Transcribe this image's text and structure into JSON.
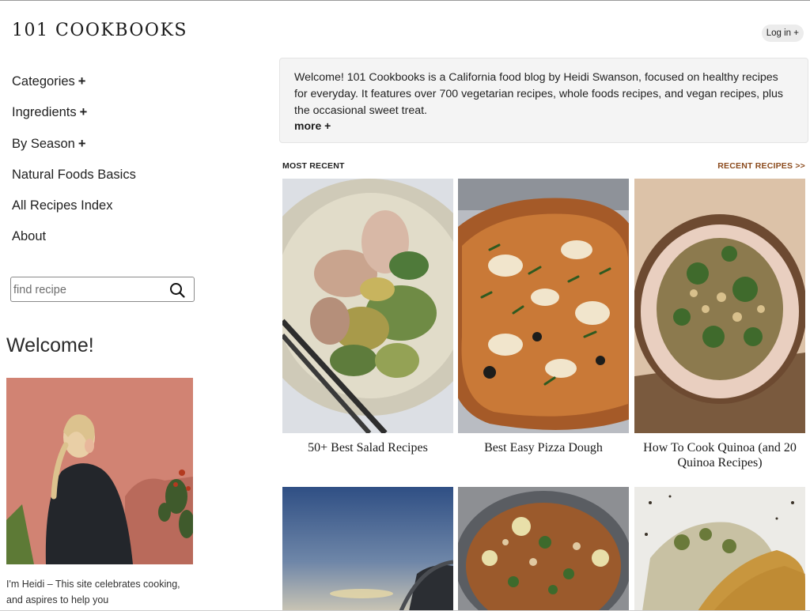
{
  "site": {
    "logo": "101 COOKBOOKS"
  },
  "header": {
    "login_label": "Log in +"
  },
  "nav": [
    {
      "label": "Categories",
      "plus": "+"
    },
    {
      "label": "Ingredients",
      "plus": "+"
    },
    {
      "label": "By Season",
      "plus": "+"
    },
    {
      "label": "Natural Foods Basics",
      "plus": ""
    },
    {
      "label": "All Recipes Index",
      "plus": ""
    },
    {
      "label": "About",
      "plus": ""
    }
  ],
  "search": {
    "placeholder": "find recipe",
    "icon": "search-icon"
  },
  "sidebar": {
    "welcome_heading": "Welcome!",
    "intro_text": "I'm Heidi – This site celebrates cooking, and aspires to help you"
  },
  "welcome_box": {
    "text": "Welcome! 101 Cookbooks is a California food blog by Heidi Swanson, focused on healthy recipes for everyday. It features over 700 vegetarian recipes, whole foods recipes, and vegan recipes, plus the occasional sweet treat.",
    "more_label": "more +"
  },
  "recent": {
    "section_label": "MOST RECENT",
    "link_label": "RECENT RECIPES >>",
    "cards": [
      {
        "title": "50+ Best Salad Recipes"
      },
      {
        "title": "Best Easy Pizza Dough"
      },
      {
        "title": "How To Cook Quinoa (and 20 Quinoa Recipes)"
      },
      {
        "title": ""
      },
      {
        "title": ""
      },
      {
        "title": ""
      }
    ]
  },
  "colors": {
    "accent_link": "#8b4a1c",
    "welcome_box_bg": "#f4f4f4",
    "login_bg": "#ececec"
  }
}
